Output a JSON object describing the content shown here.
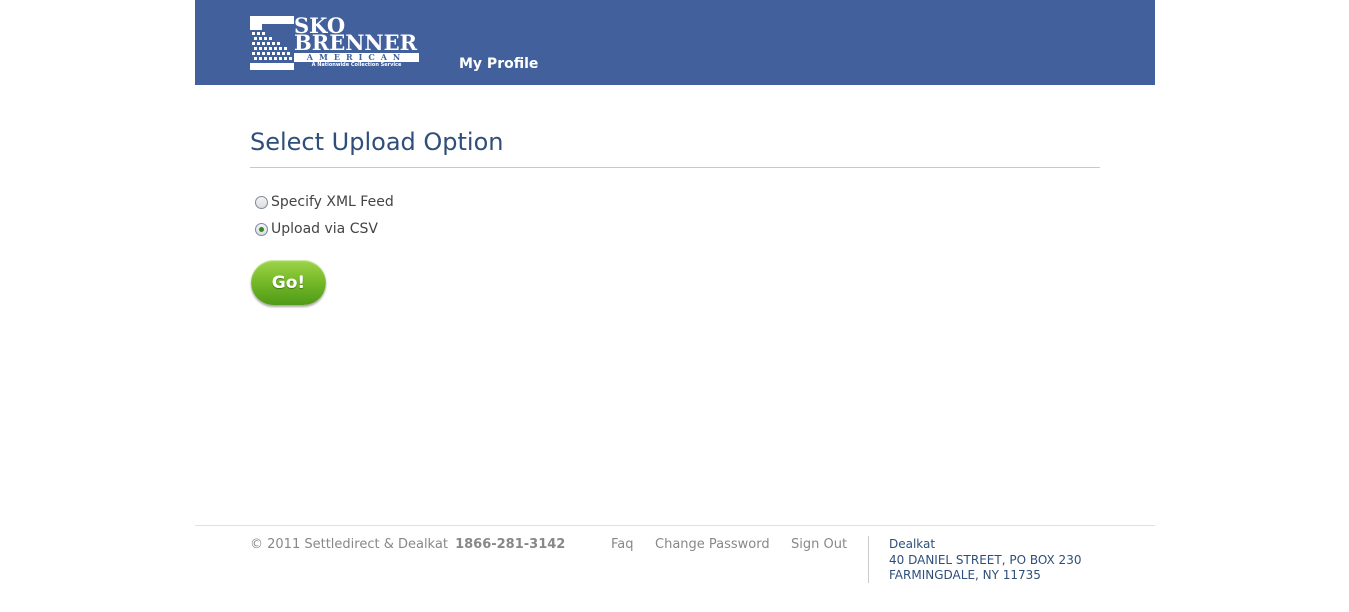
{
  "header": {
    "logo": {
      "line1": "SKO",
      "line2": "BRENNER",
      "line3": "AMERICAN",
      "tagline": "A Nationwide Collection Service"
    },
    "nav": {
      "my_profile": "My Profile"
    }
  },
  "main": {
    "title": "Select Upload Option",
    "options": [
      {
        "label": "Specify XML Feed",
        "checked": false
      },
      {
        "label": "Upload via CSV",
        "checked": true
      }
    ],
    "go_label": "Go!"
  },
  "footer": {
    "copyright": "© 2011 Settledirect & Dealkat",
    "phone": "1866-281-3142",
    "links": {
      "faq": "Faq",
      "change_password": "Change Password",
      "sign_out": "Sign Out"
    },
    "address": {
      "company": "Dealkat",
      "line1": "40 DANIEL STREET, PO BOX 230",
      "line2": "FARMINGDALE, NY 11735"
    }
  },
  "colors": {
    "header_bg": "#41609c",
    "title": "#2f4f7a",
    "go_button": "#78bb2a",
    "footer_text": "#888888"
  }
}
